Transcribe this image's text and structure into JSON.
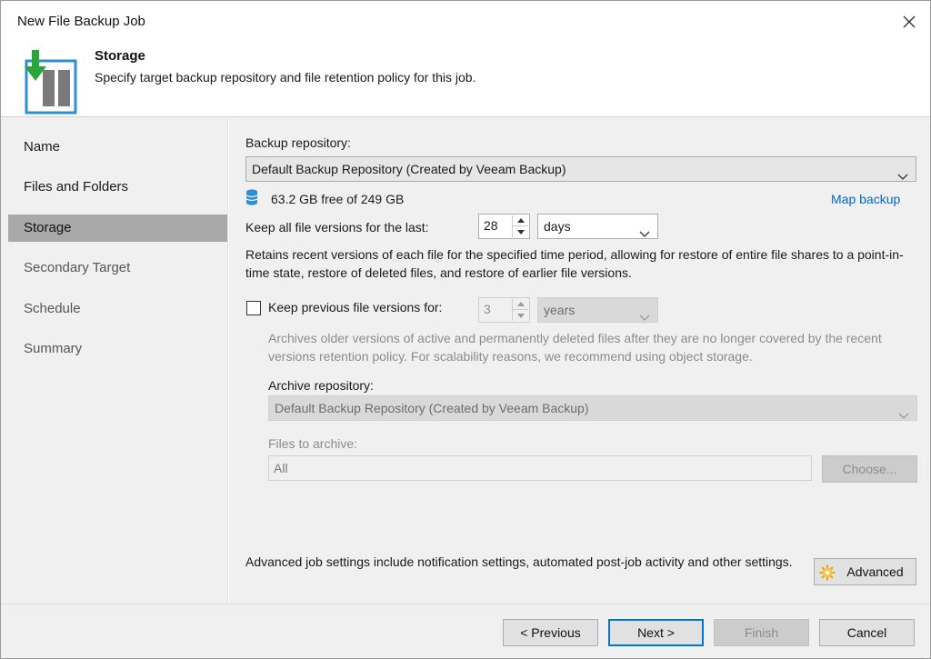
{
  "window": {
    "title": "New File Backup Job"
  },
  "header": {
    "title": "Storage",
    "subtitle": "Specify target backup repository and file retention policy for this job."
  },
  "sidebar": {
    "items": [
      {
        "label": "Name"
      },
      {
        "label": "Files and Folders"
      },
      {
        "label": "Storage"
      },
      {
        "label": "Secondary Target"
      },
      {
        "label": "Schedule"
      },
      {
        "label": "Summary"
      }
    ],
    "active": "Storage"
  },
  "storage": {
    "repo_label": "Backup repository:",
    "repo_value": "Default Backup Repository (Created by Veeam Backup)",
    "free_space": "63.2 GB free of 249 GB",
    "map_backup": "Map backup",
    "keep_label": "Keep all file versions for the last:",
    "keep_value": "28",
    "keep_unit": "days",
    "keep_desc": "Retains recent versions of each file for the specified time period, allowing for restore of entire file shares to a point-in-time state, restore of deleted files, and restore of earlier file versions.",
    "prev_label": "Keep previous file versions for:",
    "prev_checked": false,
    "prev_value": "3",
    "prev_unit": "years",
    "prev_desc": "Archives older versions of active and permanently deleted files after they are no longer covered by the recent versions retention policy. For scalability reasons, we recommend using object storage.",
    "archive_label": "Archive repository:",
    "archive_value": "Default Backup Repository (Created by Veeam Backup)",
    "files_label": "Files to archive:",
    "files_value": "All",
    "choose_label": "Choose...",
    "advanced_desc": "Advanced job settings include notification settings, automated post-job activity and other settings.",
    "advanced_label": "Advanced"
  },
  "footer": {
    "previous": "< Previous",
    "next": "Next >",
    "finish": "Finish",
    "cancel": "Cancel"
  },
  "colors": {
    "accent": "#0078d7",
    "link": "#0066cc",
    "active_nav": "#a9a9a9",
    "panel_bg": "#f0f0f0"
  }
}
